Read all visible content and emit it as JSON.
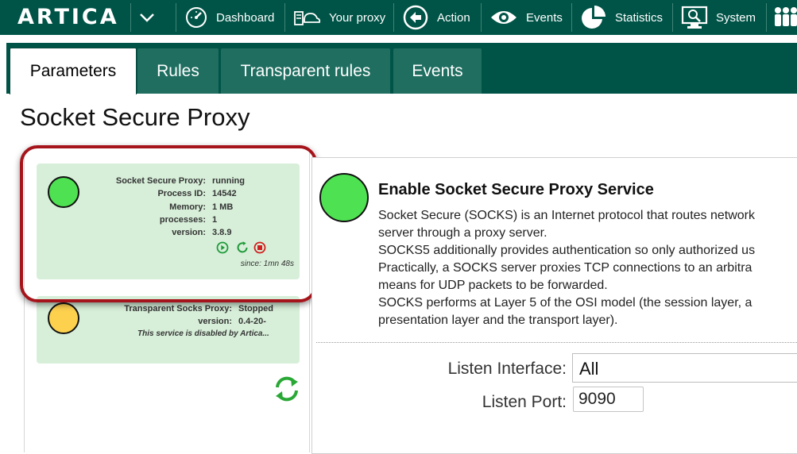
{
  "app": {
    "logo": "ARTICA"
  },
  "nav": {
    "items": [
      {
        "label": "Dashboard",
        "icon": "dashboard-icon"
      },
      {
        "label": "Your proxy",
        "icon": "proxy-icon"
      },
      {
        "label": "Action",
        "icon": "action-icon"
      },
      {
        "label": "Events",
        "icon": "eye-icon"
      },
      {
        "label": "Statistics",
        "icon": "pie-chart-icon"
      },
      {
        "label": "System",
        "icon": "system-icon"
      }
    ]
  },
  "tabs": [
    {
      "label": "Parameters",
      "active": true
    },
    {
      "label": "Rules",
      "active": false
    },
    {
      "label": "Transparent rules",
      "active": false
    },
    {
      "label": "Events",
      "active": false
    }
  ],
  "page": {
    "title": "Socket Secure Proxy"
  },
  "status_cards": {
    "socks": {
      "status_color": "#4ee152",
      "rows": [
        {
          "key": "Socket Secure Proxy:",
          "value": "running"
        },
        {
          "key": "Process ID:",
          "value": "14542"
        },
        {
          "key": "Memory:",
          "value": "1 MB"
        },
        {
          "key": "processes:",
          "value": "1"
        },
        {
          "key": "version:",
          "value": "3.8.9"
        }
      ],
      "since": "since: 1mn 48s"
    },
    "transparent": {
      "status_color": "#fdd14e",
      "rows": [
        {
          "key": "Transparent Socks Proxy:",
          "value": "Stopped"
        },
        {
          "key": "version:",
          "value": "0.4-20-"
        }
      ],
      "note": "This service is disabled by Artica..."
    }
  },
  "service": {
    "title": "Enable Socket Secure Proxy Service",
    "description": [
      "Socket Secure (SOCKS) is an Internet protocol that routes network",
      "server through a proxy server.",
      "SOCKS5 additionally provides authentication so only authorized us",
      "Practically, a SOCKS server proxies TCP connections to an arbitra",
      "means for UDP packets to be forwarded.",
      "SOCKS performs at Layer 5 of the OSI model (the session layer, a",
      "presentation layer and the transport layer)."
    ],
    "enabled_color": "#4ee152"
  },
  "form": {
    "interface_label": "Listen Interface:",
    "interface_value": "All",
    "port_label": "Listen Port:",
    "port_value": "9090"
  },
  "colors": {
    "header": "#005447",
    "tab": "#1f6e60",
    "card": "#d7efd9",
    "highlight": "#a6141b"
  }
}
